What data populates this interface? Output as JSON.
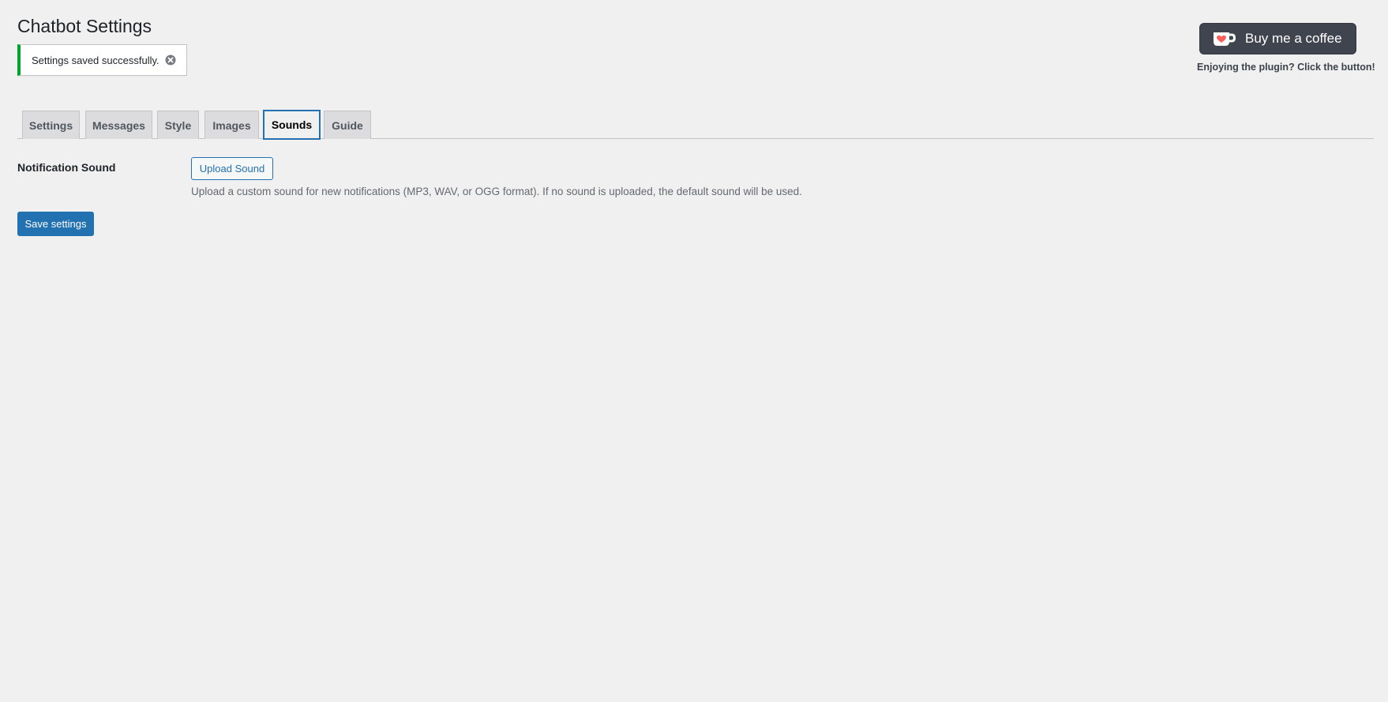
{
  "page": {
    "title": "Chatbot Settings"
  },
  "notice": {
    "message": "Settings saved successfully.",
    "type": "success",
    "accent_color": "#00a32a",
    "dismiss_icon": "close-circle-icon"
  },
  "coffee": {
    "label": "Buy me a coffee",
    "caption": "Enjoying the plugin? Click the button!",
    "icon": "coffee-cup-heart-icon",
    "background_color": "#40444f",
    "heart_color": "#ff5e5b"
  },
  "tabs": [
    {
      "label": "Settings",
      "active": false
    },
    {
      "label": "Messages",
      "active": false
    },
    {
      "label": "Style",
      "active": false
    },
    {
      "label": "Images",
      "active": false
    },
    {
      "label": "Sounds",
      "active": true
    },
    {
      "label": "Guide",
      "active": false
    }
  ],
  "sounds": {
    "field_label": "Notification Sound",
    "upload_label": "Upload Sound",
    "description": "Upload a custom sound for new notifications (MP3, WAV, or OGG format). If no sound is uploaded, the default sound will be used."
  },
  "form": {
    "save_label": "Save settings"
  },
  "colors": {
    "primary": "#2271b1",
    "background": "#f0f0f1"
  }
}
